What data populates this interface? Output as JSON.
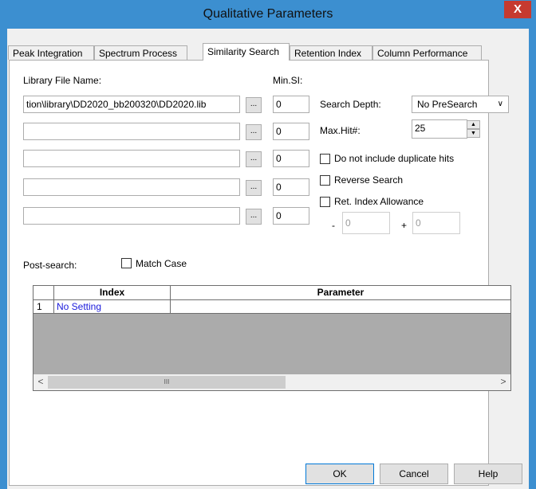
{
  "window": {
    "title": "Qualitative Parameters",
    "close_glyph": "X"
  },
  "tabs": [
    {
      "label": "Peak Integration",
      "active": false
    },
    {
      "label": "Spectrum Process",
      "active": false
    },
    {
      "label": "Similarity Search",
      "active": true
    },
    {
      "label": "Retention Index",
      "active": false
    },
    {
      "label": "Column Performance",
      "active": false
    }
  ],
  "library": {
    "label": "Library File Name:",
    "min_si_label": "Min.SI:",
    "browse_label": "...",
    "rows": [
      {
        "path": "tion\\library\\DD2020_bb200320\\DD2020.lib",
        "min_si": "0"
      },
      {
        "path": "",
        "min_si": "0"
      },
      {
        "path": "",
        "min_si": "0"
      },
      {
        "path": "",
        "min_si": "0"
      },
      {
        "path": "",
        "min_si": "0"
      }
    ]
  },
  "search_depth": {
    "label": "Search Depth:",
    "value": "No PreSearch"
  },
  "max_hit": {
    "label": "Max.Hit#:",
    "value": "25"
  },
  "options": {
    "no_duplicates": {
      "label": "Do not include duplicate hits",
      "checked": false
    },
    "reverse_search": {
      "label": "Reverse Search",
      "checked": false
    },
    "ret_index_allowance": {
      "label": "Ret. Index Allowance",
      "checked": false
    }
  },
  "allowance": {
    "minus_label": "-",
    "minus_value": "0",
    "plus_label": "+",
    "plus_value": "0"
  },
  "post_search": {
    "label": "Post-search:",
    "match_case_label": "Match Case",
    "match_case_checked": false
  },
  "grid": {
    "columns": [
      "Index",
      "Parameter"
    ],
    "rows": [
      {
        "num": "1",
        "index": "No Setting",
        "parameter": ""
      }
    ],
    "scroll_thumb": "III"
  },
  "buttons": {
    "ok": "OK",
    "cancel": "Cancel",
    "help": "Help"
  },
  "colors": {
    "titlebar": "#3c8fd0",
    "close": "#c63a2f",
    "link_text": "#1a1adb"
  }
}
